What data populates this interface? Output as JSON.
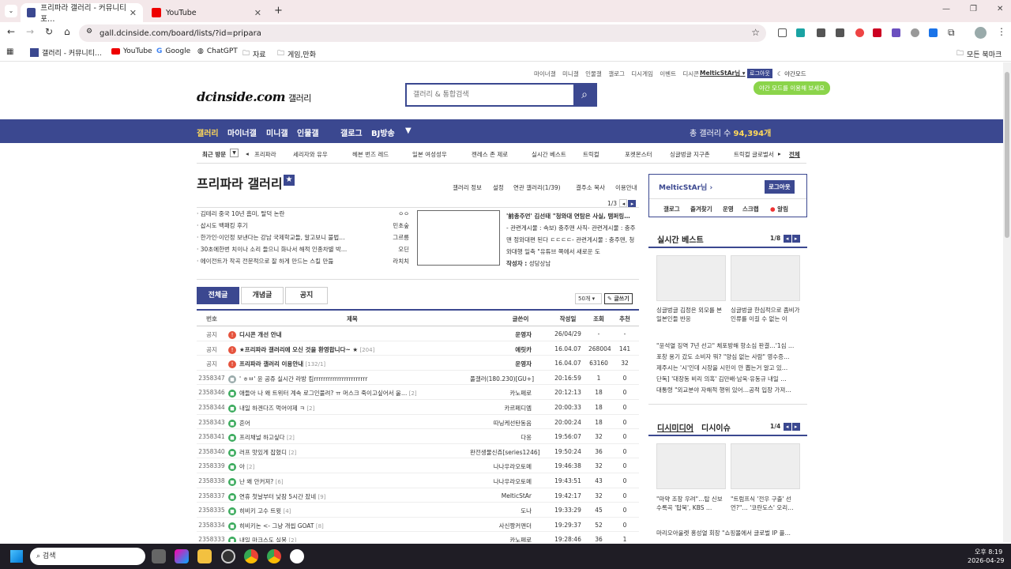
{
  "browser": {
    "tabs": [
      {
        "label": "프리파라 갤러리 - 커뮤니티 포…"
      },
      {
        "label": "YouTube"
      }
    ],
    "url": "gall.dcinside.com/board/lists/?id=pripara",
    "bookmarks": [
      "갤러리 - 커뮤니티…",
      "YouTube",
      "Google",
      "ChatGPT",
      "자료",
      "게임,만화"
    ],
    "bookmarks_all": "모든 북마크"
  },
  "site": {
    "toplinks": [
      "마이너갤",
      "미니갤",
      "인물갤",
      "갤로그",
      "디시게임",
      "이벤트",
      "디시콘"
    ],
    "user": "MelticStAr님",
    "logout": "로그아웃",
    "dark_mode": "야간모드",
    "tooltip": "야간 모드를 이용해 보세요",
    "logo": "dcinside.com",
    "logo_suffix": "갤러리",
    "search_placeholder": "갤러리 & 통합검색",
    "gnb": [
      "갤러리",
      "마이너갤",
      "미니갤",
      "인물갤",
      "갤로그",
      "BJ방송"
    ],
    "total_label": "총 갤러리 수",
    "total_value": "94,394개",
    "recent_label": "최근 방문",
    "recent": [
      "프리파라",
      "세리자와 유우",
      "헤븐 번즈 레드",
      "일본 여성성우",
      "젠레스 존 제로",
      "실시간 베스트",
      "트릭컬",
      "포켓몬스터",
      "싱글벙글 지구촌",
      "트릭컬 글로벌서"
    ],
    "recent_all": "전체"
  },
  "gallery": {
    "title": "프리파라 갤러리",
    "info": [
      "갤러리 정보",
      "설정",
      "연관 갤러리(1/39)",
      "결주소 복사",
      "이용안내"
    ],
    "news_page": "1/3",
    "news": [
      {
        "t": "김테리 중국 10년 흠미, 탈덕 논란",
        "a": "ㅇㅇ"
      },
      {
        "t": "삽시도 백패킹 후기",
        "a": "민초숲"
      },
      {
        "t": "한가인·이민정 보낸다는 강남 국제학교들, 알고보니 불법…",
        "a": "그르릉"
      },
      {
        "t": "30초에한번 치이나 소리 들으니 화나서 해적 인종차별 박…",
        "a": "오딘"
      },
      {
        "t": "에이전트가 작곡 전문적으로 잘 하게 만드는 스킬 만듦",
        "a": "라치치"
      }
    ],
    "feature": {
      "title": "'前총주먼' 김선태 \"청와대 연탐은 사실, 탬퍼링…",
      "body": "- 관련게시물 : 속보) 충주맨 사직- 관련게시물 : 충주맨 정와대편 된다 ㄷㄷㄷㄷ- 관련게시물 : 충주맨, 청와대행 일축 \"유튜브 쪽에서 새로운 도",
      "author_label": "작성자 :",
      "author": "성당상남"
    },
    "tabs": [
      "전체글",
      "개념글",
      "공지"
    ],
    "per_page": "50개",
    "write": "글쓰기",
    "headers": [
      "번호",
      "제목",
      "글쓴이",
      "작성일",
      "조회",
      "추천"
    ],
    "rows": [
      {
        "n": "공지",
        "t": "디시콘 개선 안내",
        "c": "",
        "w": "운영자",
        "d": "26/04/29",
        "v": "-",
        "r": "-",
        "type": "notice"
      },
      {
        "n": "공지",
        "t": "★프리파라 갤러리에 오신 것을 환영합니다~ ★",
        "c": "[204]",
        "w": "에릿카",
        "d": "16.04.07",
        "v": "268004",
        "r": "141",
        "type": "notice"
      },
      {
        "n": "공지",
        "t": "프리파라 갤러리 이용안내",
        "c": "[132/1]",
        "w": "운영자",
        "d": "16.04.07",
        "v": "63160",
        "r": "32",
        "type": "notice"
      },
      {
        "n": "2358347",
        "t": "' ㅎㅂ' 윤 공쥬 실시간 라방 킴rrrrrrrrrrrrrrrrrrrrrrr",
        "c": "",
        "w": "풀갤러(180.230)[GU+]",
        "d": "20:16:59",
        "v": "1",
        "r": "0",
        "type": "chat"
      },
      {
        "n": "2358346",
        "t": "애들아 나 왜 트위터 계속 로그인풀려? ㅠ 머스크 죽이고싶어서 울…",
        "c": "[2]",
        "w": "카노페로",
        "d": "20:12:13",
        "v": "18",
        "r": "0",
        "type": "post"
      },
      {
        "n": "2358344",
        "t": "내일 하겐다즈 먹어야제 ㅋ",
        "c": "[2]",
        "w": "카르페디엠",
        "d": "20:00:33",
        "v": "18",
        "r": "0",
        "type": "post"
      },
      {
        "n": "2358343",
        "t": "흔어",
        "c": "",
        "w": "따닝케선탄동음",
        "d": "20:00:24",
        "v": "18",
        "r": "0",
        "type": "post"
      },
      {
        "n": "2358341",
        "t": "프리채널 하고싶다",
        "c": "[2]",
        "w": "다옹",
        "d": "19:56:07",
        "v": "32",
        "r": "0",
        "type": "post"
      },
      {
        "n": "2358340",
        "t": "러프 맛있게 잡혔디",
        "c": "[2]",
        "w": "완전생물신쥬[series1246]",
        "d": "19:50:24",
        "v": "36",
        "r": "0",
        "type": "post"
      },
      {
        "n": "2358339",
        "t": "아",
        "c": "[2]",
        "w": "나나우라오토메",
        "d": "19:46:38",
        "v": "32",
        "r": "0",
        "type": "post"
      },
      {
        "n": "2358338",
        "t": "난 왜 안커져?",
        "c": "[6]",
        "w": "나나우라오토메",
        "d": "19:43:51",
        "v": "43",
        "r": "0",
        "type": "post"
      },
      {
        "n": "2358337",
        "t": "연휴 첫날부터 낮잠 5시간 잤네",
        "c": "[9]",
        "w": "MelticStAr",
        "d": "19:42:17",
        "v": "32",
        "r": "0",
        "type": "post"
      },
      {
        "n": "2358335",
        "t": "히비키 고수 트윗",
        "c": "[4]",
        "w": "도나",
        "d": "19:33:29",
        "v": "45",
        "r": "0",
        "type": "post"
      },
      {
        "n": "2358334",
        "t": "히비키논 <- 그냥 개씹 GOAT",
        "c": "[8]",
        "w": "사신짱커맨더",
        "d": "19:29:37",
        "v": "52",
        "r": "0",
        "type": "post"
      },
      {
        "n": "2358333",
        "t": "내일 마크스도 실봉",
        "c": "[2]",
        "w": "카노페로",
        "d": "19:28:46",
        "v": "36",
        "r": "1",
        "type": "post"
      }
    ]
  },
  "sidebar": {
    "user": "MelticStAr님",
    "logout": "로그아웃",
    "links": [
      "갤로그",
      "즐겨찾기",
      "운영",
      "스크랩",
      "알림"
    ],
    "best_title": "실시간 베스트",
    "best_page": "1/8",
    "best_tiles": [
      "싱글벙글 김정은 외모를 본 일본인들 반응",
      "싱글벙글 한심적으로 좀비가 인류를 이길 수 없는 이"
    ],
    "best_list": [
      "\"윤석열 징역 7년 선고\" 체포방해 항소심 판결…'1심 …",
      "포창 용기 갔도 소비자 뭐? \"양심 없는 사람\" 영수증…",
      "제주시는 '시'인데 시장을 시민이 안 뽑는거 알고 있…",
      "단독] '대장동 비리 의혹' 김만배·남욱·유동규 내일 …",
      "대통령 \"외교분야 자해적 행위 있어…공적 입장 가져…"
    ],
    "media_title": "디시미디어",
    "issue_title": "디시이슈",
    "media_page": "1/4",
    "media_tiles": [
      "\"마약 조장 우려\"…탑 신보 수록곡 '탑묵', KBS …",
      "\"트럼프식 '전우 구출' 선언?\"… '코란도스' 오리…"
    ],
    "media_list": [
      "마리오아울렛 홍성열 회장 \"쇼핑몰에서 글로벌 IP 플…"
    ]
  },
  "taskbar": {
    "search": "검색",
    "time": "오후 8:19",
    "date": "2026-04-29"
  }
}
